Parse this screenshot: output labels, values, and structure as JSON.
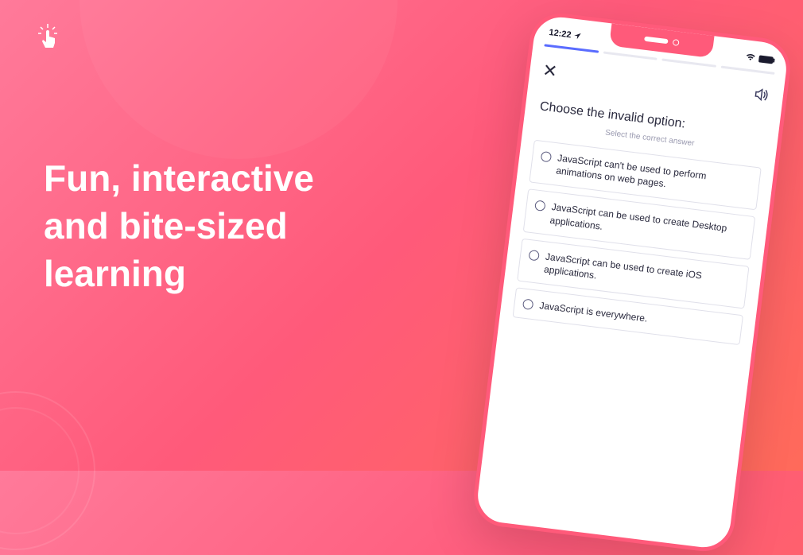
{
  "headline": "Fun, interactive\nand bite-sized\nlearning",
  "phone": {
    "status": {
      "time": "12:22",
      "location_arrow": "➤"
    },
    "question": "Choose the invalid option:",
    "hint": "Select the correct answer",
    "options": [
      "JavaScript can't be used to perform animations on web pages.",
      "JavaScript can be used to create Desktop applications.",
      "JavaScript can be used to create iOS applications.",
      "JavaScript is everywhere."
    ]
  }
}
